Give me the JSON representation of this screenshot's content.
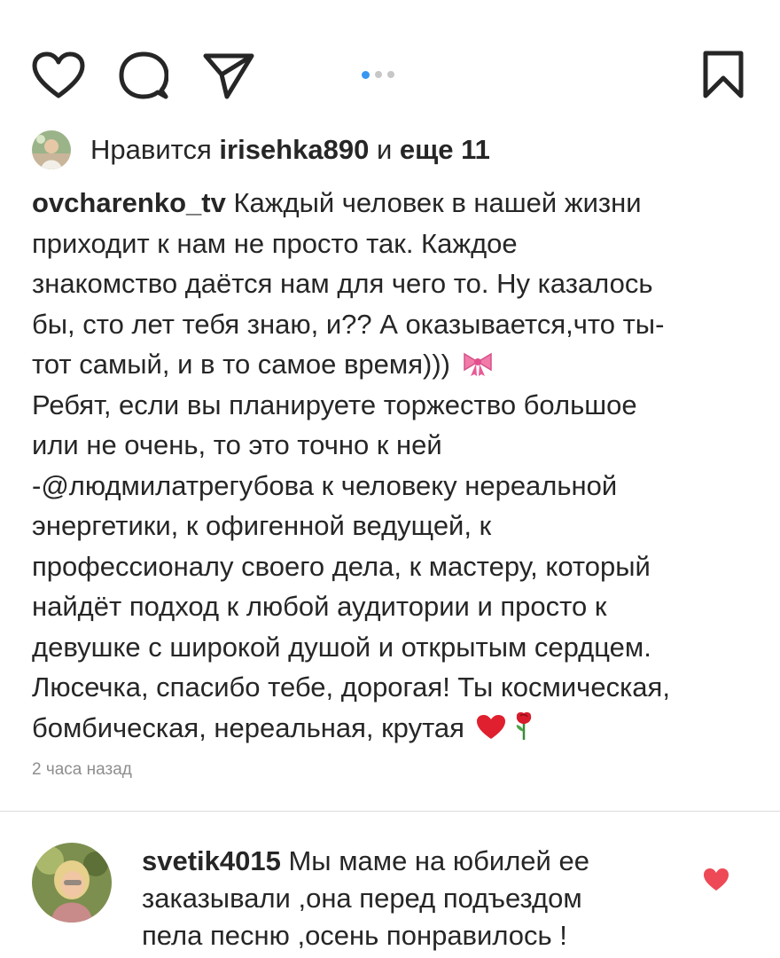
{
  "actions": {
    "like_icon": "heart-outline-icon",
    "comment_icon": "comment-bubble-icon",
    "share_icon": "paper-plane-icon",
    "save_icon": "bookmark-icon",
    "carousel": {
      "total": 3,
      "active_index": 0
    },
    "accent_color": "#3897f0"
  },
  "likes": {
    "prefix": "Нравится ",
    "user": "irisehka890",
    "middle": " и ",
    "others": "еще 11"
  },
  "post": {
    "username": "ovcharenko_tv",
    "caption_lines": [
      " Каждый человек в нашей жизни",
      "приходит к нам не просто так. Каждое",
      "знакомство даётся нам для чего то. Ну казалось",
      "бы, сто лет тебя знаю, и?? А оказывается,что ты-",
      "тот самый, и в то самое время)))",
      "Ребят, если вы планируете торжество большое",
      "или не очень, то это точно к ней",
      "-@людмилатрегубова к человеку нереальной",
      "энергетики, к офигенной ведущей, к",
      "профессионалу своего дела, к мастеру, который",
      "найдёт подход к любой аудитории и просто к",
      "девушке с широкой душой и открытым сердцем.",
      "Люсечка, спасибо тебе, дорогая! Ты космическая,",
      "бомбическая, нереальная, крутая"
    ],
    "emoji_line5": "ribbon-emoji",
    "emoji_line14": [
      "red-heart-emoji",
      "rose-emoji"
    ],
    "time": "2 часа назад"
  },
  "comment": {
    "username": "svetik4015",
    "lines": [
      " Мы маме на юбилей ее",
      "заказывали ,она перед подъездом",
      "пела песню ,осень понравилось !"
    ],
    "heart_color": "#ed4956"
  }
}
